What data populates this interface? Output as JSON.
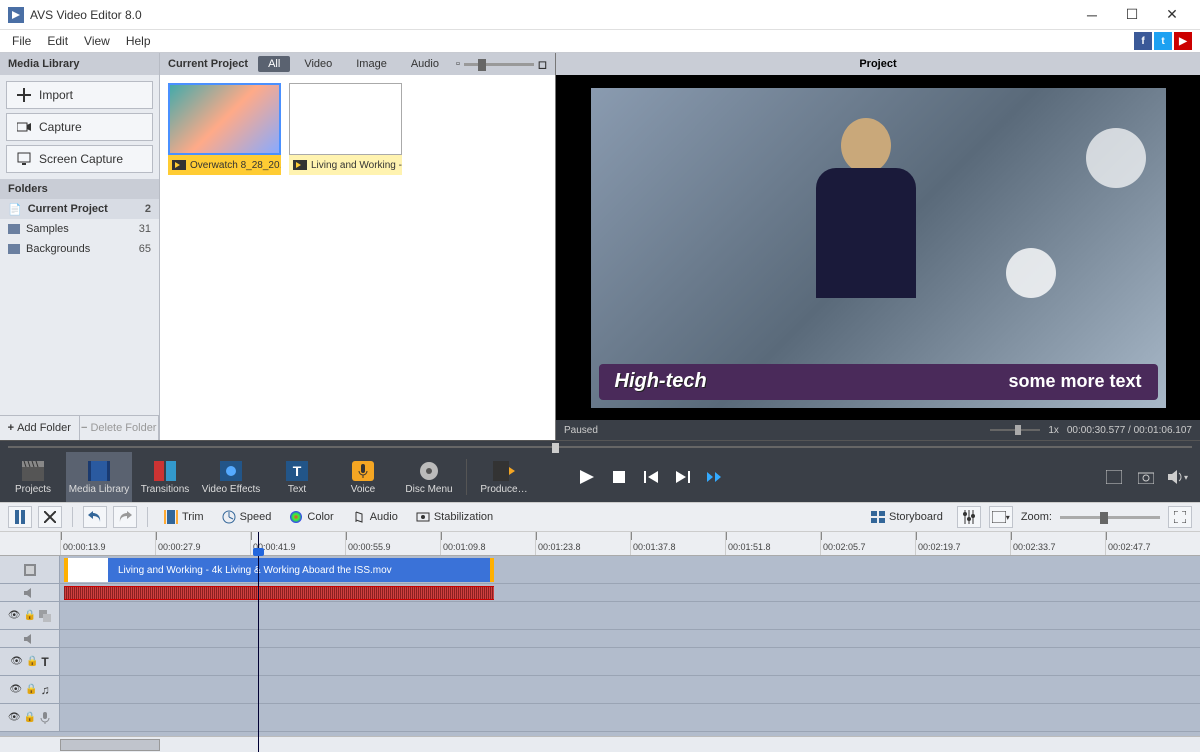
{
  "window": {
    "title": "AVS Video Editor 8.0"
  },
  "menu": {
    "file": "File",
    "edit": "Edit",
    "view": "View",
    "help": "Help"
  },
  "panels": {
    "media_library": "Media Library",
    "current_project": "Current Project",
    "project": "Project",
    "folders": "Folders"
  },
  "sidebar_buttons": {
    "import": "Import",
    "capture": "Capture",
    "screen_capture": "Screen Capture"
  },
  "folders": [
    {
      "name": "Current Project",
      "count": "2",
      "selected": true
    },
    {
      "name": "Samples",
      "count": "31"
    },
    {
      "name": "Backgrounds",
      "count": "65"
    }
  ],
  "folder_buttons": {
    "add": "Add Folder",
    "delete": "Delete Folder"
  },
  "filters": {
    "all": "All",
    "video": "Video",
    "image": "Image",
    "audio": "Audio"
  },
  "clips": [
    {
      "label": "Overwatch 8_28_20…",
      "selected": true
    },
    {
      "label": "Living and Working - …"
    }
  ],
  "preview": {
    "status": "Paused",
    "speed": "1x",
    "time": "00:00:30.577 / 00:01:06.107",
    "subtitle_left": "High-tech",
    "subtitle_right": "some more text"
  },
  "main_toolbar": {
    "projects": "Projects",
    "media_library": "Media Library",
    "transitions": "Transitions",
    "video_effects": "Video Effects",
    "text": "Text",
    "voice": "Voice",
    "disc_menu": "Disc Menu",
    "produce": "Produce…"
  },
  "edit_toolbar": {
    "trim": "Trim",
    "speed": "Speed",
    "color": "Color",
    "audio": "Audio",
    "stabilization": "Stabilization",
    "storyboard": "Storyboard",
    "zoom": "Zoom:"
  },
  "ruler": [
    "00:00:13.9",
    "00:00:27.9",
    "00:00:41.9",
    "00:00:55.9",
    "00:01:09.8",
    "00:01:23.8",
    "00:01:37.8",
    "00:01:51.8",
    "00:02:05.7",
    "00:02:19.7",
    "00:02:33.7",
    "00:02:47.7"
  ],
  "timeline_clip": "Living and Working - 4k Living & Working Aboard the ISS.mov"
}
